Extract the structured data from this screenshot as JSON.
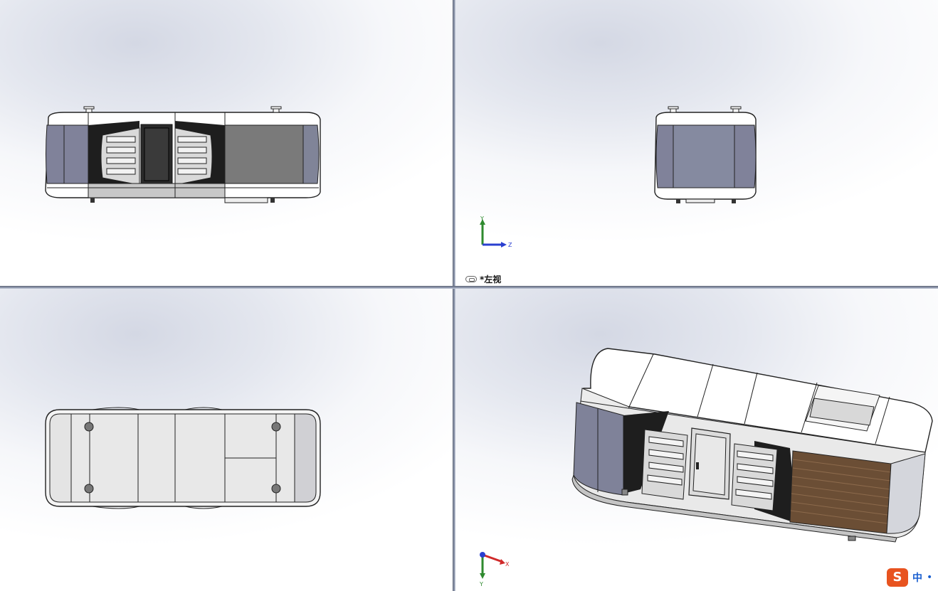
{
  "views": {
    "top_left": {
      "name": "front-view"
    },
    "top_right": {
      "name": "left-view",
      "label": "*左视"
    },
    "bottom_left": {
      "name": "top-view"
    },
    "bottom_right": {
      "name": "isometric-view"
    }
  },
  "triads": {
    "left_view": {
      "axes": [
        "Y",
        "Z"
      ]
    },
    "iso_view": {
      "axes": [
        "Y",
        "X"
      ]
    }
  },
  "ime": {
    "logo": "S",
    "mode": "中",
    "punct": "•"
  },
  "colors": {
    "panel_blue": "#7d7f95",
    "wood": "#6b4e35",
    "axis_y": "#2e8a2e",
    "axis_z": "#2a3fd0",
    "axis_x": "#d02a2a",
    "ime_orange": "#e8531f"
  }
}
